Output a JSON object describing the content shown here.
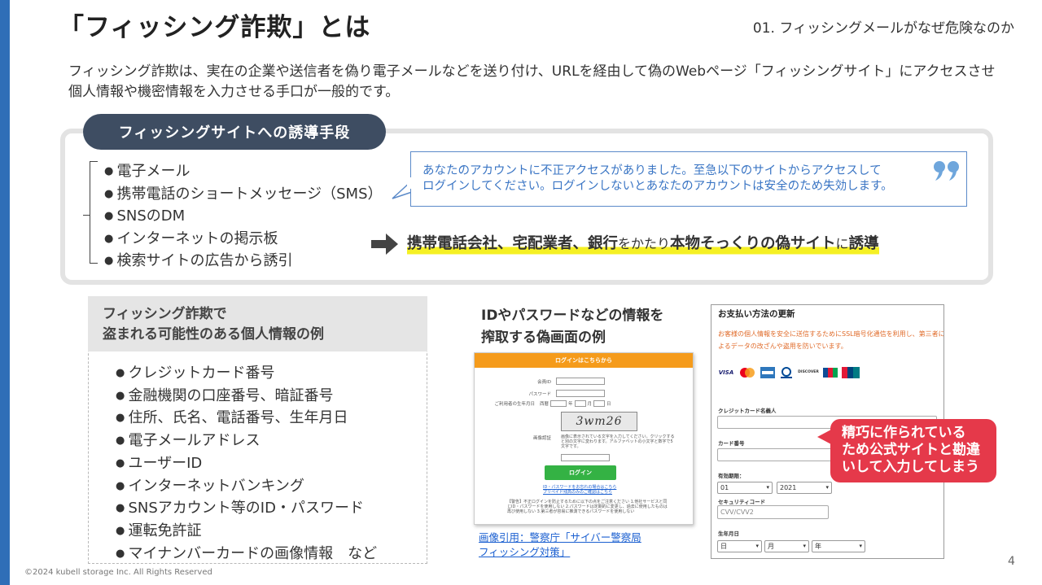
{
  "header": {
    "title": "「フィッシング詐欺」とは",
    "section": "01. フィッシングメールがなぜ危険なのか"
  },
  "intro": "フィッシング詐欺は、実在の企業や送信者を偽り電子メールなどを送り付け、URLを経由して偽のWebページ「フィッシングサイト」にアクセスさせ個人情報や機密情報を入力させる手口が一般的です。",
  "methods": {
    "label": "フィッシングサイトへの誘導手段",
    "items": [
      "電子メール",
      "携帯電話のショートメッセージ（SMS）",
      "SNSのDM",
      "インターネットの掲示板",
      "検索サイトの広告から誘引"
    ],
    "message_line1": "あなたのアカウントに不正アクセスがありました。至急以下のサイトからアクセスして",
    "message_line2": "ログインしてください。ログインしないとあなたのアカウントは安全のため失効します。",
    "lure_part1": "携帯電話会社、宅配業者、銀行",
    "lure_part2": "をかたり",
    "lure_part3": "本物そっくりの偽サイト",
    "lure_part4": "に",
    "lure_part5": "誘導"
  },
  "stolen_info": {
    "heading_line1": "フィッシング詐欺で",
    "heading_line2": "盗まれる可能性のある個人情報の例",
    "items": [
      "クレジットカード番号",
      "金融機関の口座番号、暗証番号",
      "住所、氏名、電話番号、生年月日",
      "電子メールアドレス",
      "ユーザーID",
      "インターネットバンキング",
      "SNSアカウント等のID・パスワード",
      "運転免許証",
      "マイナンバーカードの画像情報　など"
    ]
  },
  "fake_example": {
    "caption_line1": "IDやパスワードなどの情報を",
    "caption_line2": "搾取する偽画面の例",
    "login": {
      "bar": "ログインはこちらから",
      "member_label": "会員ID",
      "password_label": "パスワード",
      "birth_label": "ご利用者の生年月日",
      "era": "西暦",
      "year_unit": "年",
      "month_unit": "月",
      "day_unit": "日",
      "captcha_label": "画像認証",
      "captcha_text": "3wm26",
      "captcha_note": "画像に表示されている文字を入力してください。クリックすると別の文字に変わります。アルファベットの小文字と数字で5文字です。",
      "button": "ログイン",
      "link1": "ID・パスワードをお忘れの場合はこちら",
      "link2": "プリペイド残高のみのご確認はこちら",
      "warn": "【警告】不正ログインを防止するために以下の点をご注意ください 1.他社サービスと同じID・パスワードを使用しない 2.パスワードは定期的に変更し、過去に使用したものは再び使用しない 3.第三者が容易に推測できるパスワードを使用しない"
    },
    "source_line1": "画像引用：警察庁「サイバー警察局",
    "source_line2": "フィッシング対策」"
  },
  "fake_payment": {
    "title": "お支払い方法の更新",
    "note": "お客様の個人情報を安全に送信するためにSSL暗号化通信を利用し、第三者によるデータの改ざんや盗用を防いでいます。",
    "cards": [
      "VISA",
      "MC",
      "AMEX",
      "Diners",
      "DISCOVER",
      "JCB",
      "UnionPay"
    ],
    "holder_label": "クレジットカード名義人",
    "number_label": "カード番号",
    "expiry_label": "有効期限：",
    "month_value": "01",
    "year_value": "2021",
    "cvv_label": "セキュリティコード",
    "cvv_placeholder": "CVV/CVV2",
    "birth_label": "生年月日",
    "birth_day": "日",
    "birth_month": "月",
    "birth_year": "年"
  },
  "callout_line1": "精巧に作られている",
  "callout_line2": "ため公式サイトと勘違",
  "callout_line3": "いして入力してしまう",
  "footer": {
    "copyright": "©2024 kubell storage Inc. All Rights Reserved",
    "page": "4"
  },
  "colors": {
    "accent_bar": "#2f6eb7",
    "label_bg": "#3e4d62",
    "highlight": "#f5f024",
    "callout": "#e5394a",
    "bubble_text": "#3a75c4"
  }
}
